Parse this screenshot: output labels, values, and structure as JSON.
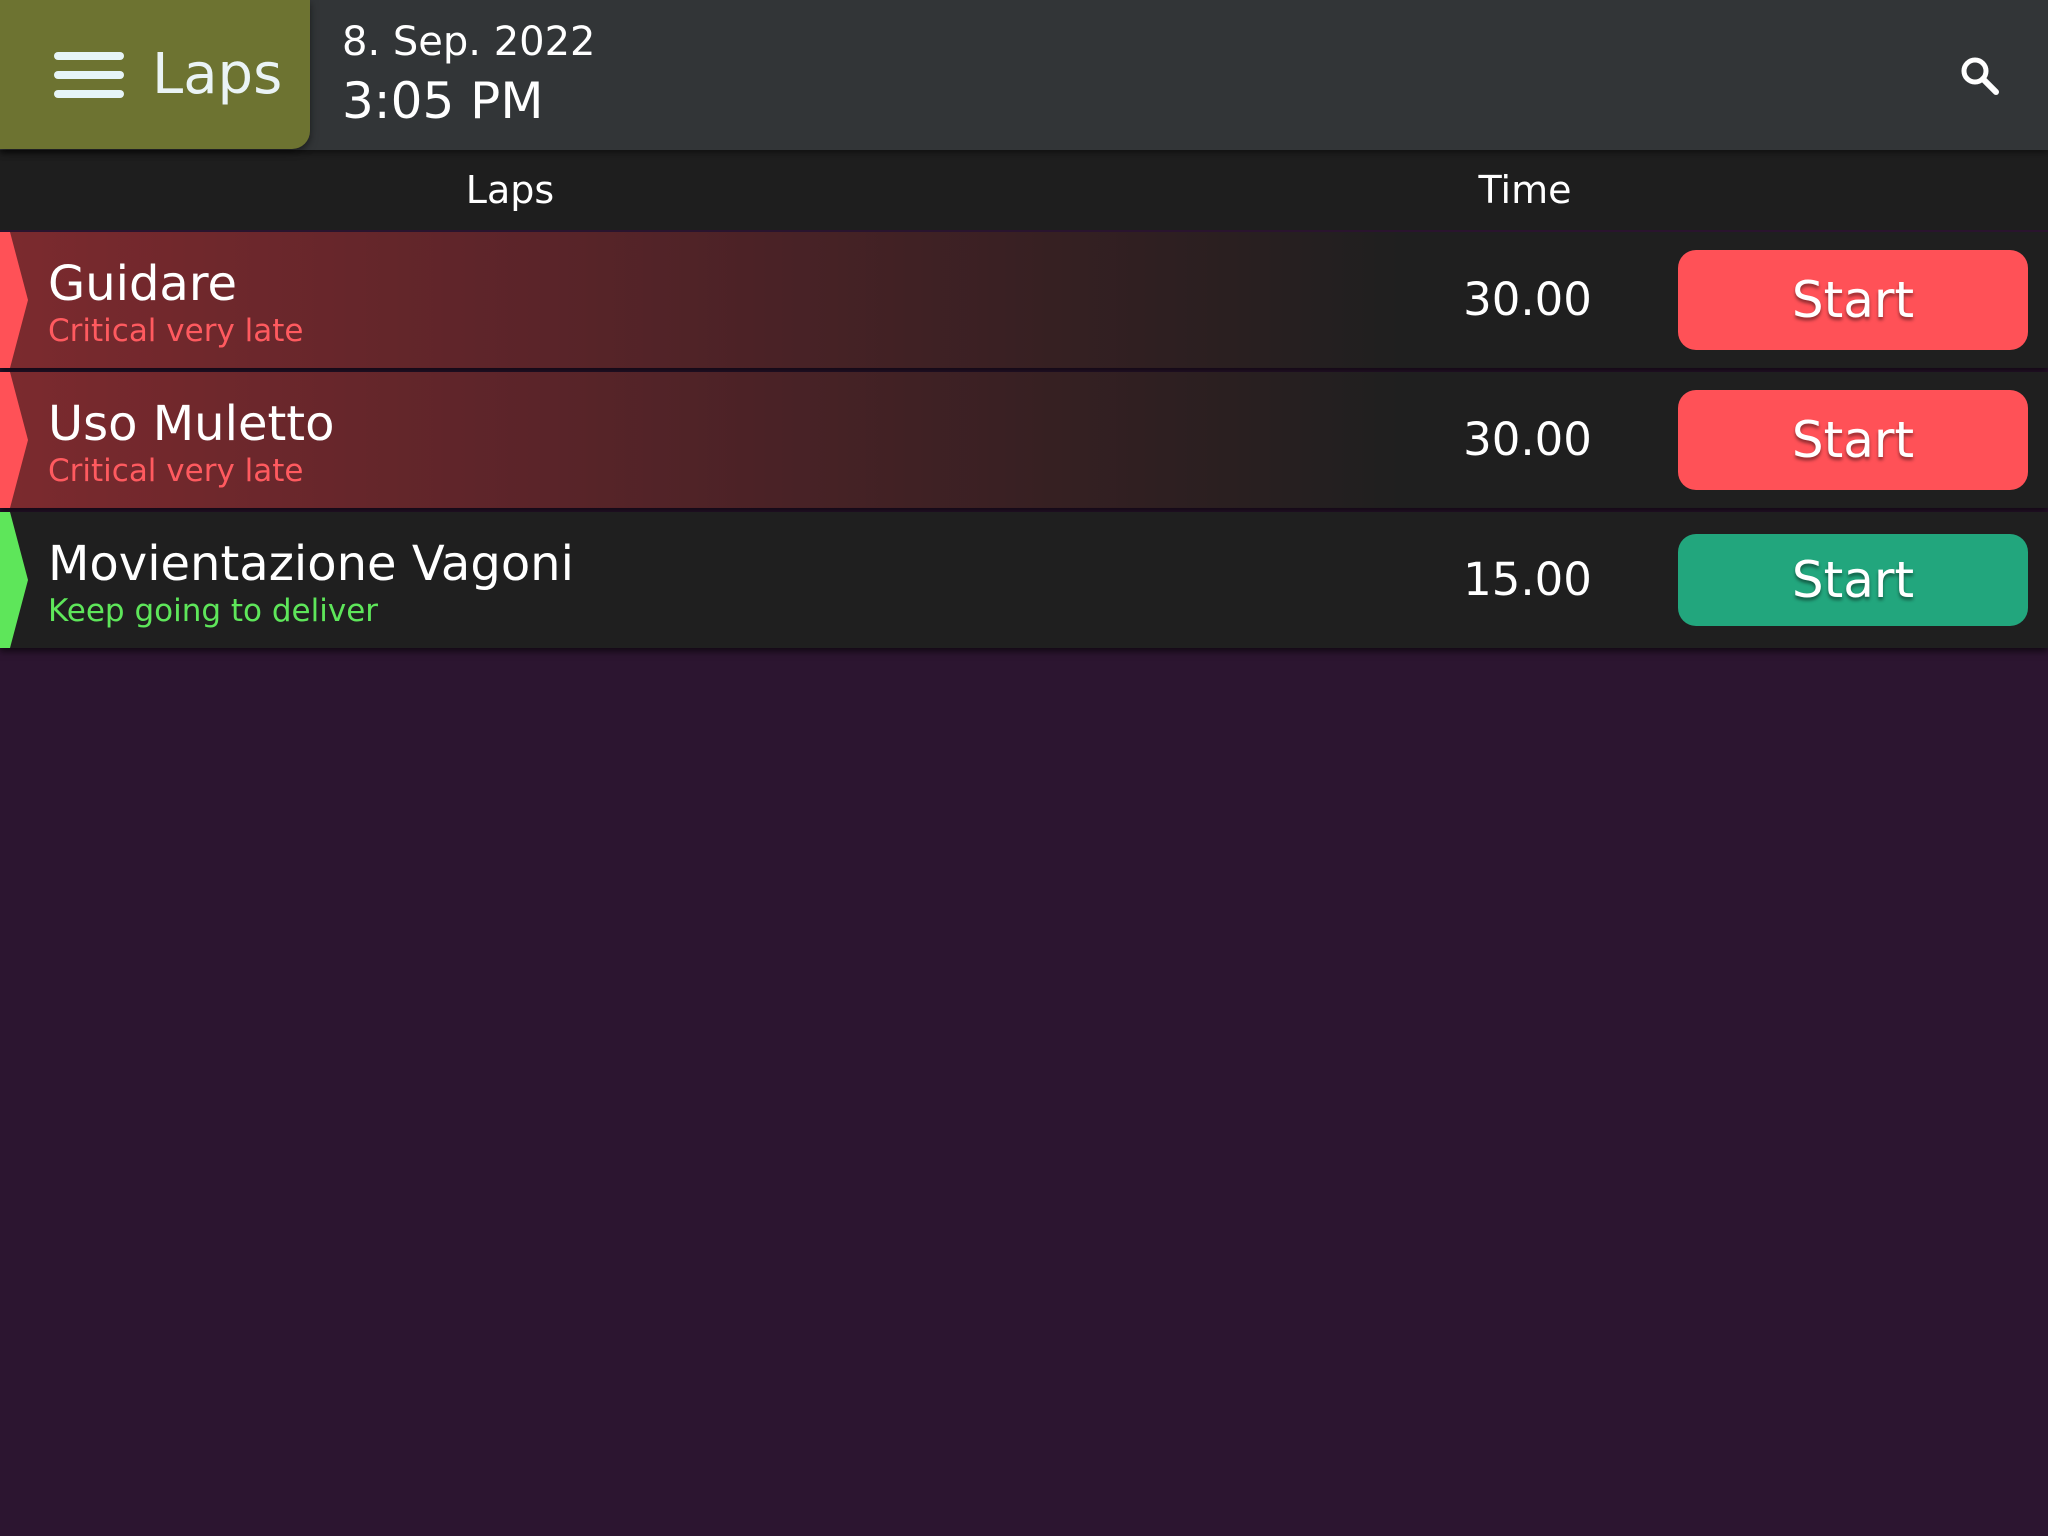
{
  "header": {
    "menu_label": "Laps",
    "date": "8. Sep. 2022",
    "time": "3:05 PM",
    "menu_icon": "menu-icon",
    "search_icon": "search-icon"
  },
  "table": {
    "columns": [
      "Laps",
      "Time"
    ],
    "rows": [
      {
        "name": "Guidare",
        "status": "Critical very late",
        "time": "30.00",
        "action": "Start",
        "status_color": "#ff5a5f",
        "button_color": "#ff5157"
      },
      {
        "name": "Uso Muletto",
        "status": "Critical very late",
        "time": "30.00",
        "action": "Start",
        "status_color": "#ff5a5f",
        "button_color": "#ff5157"
      },
      {
        "name": "Movientazione Vagoni",
        "status": "Keep going to deliver",
        "time": "15.00",
        "action": "Start",
        "status_color": "#5ee65a",
        "button_color": "#22a67d"
      }
    ]
  },
  "colors": {
    "background": "#2c1530",
    "app_bar": "#323537",
    "menu_box": "#6d7331",
    "critical": "#ff5157",
    "ok": "#5ee65a",
    "ok_button": "#22a67d"
  }
}
